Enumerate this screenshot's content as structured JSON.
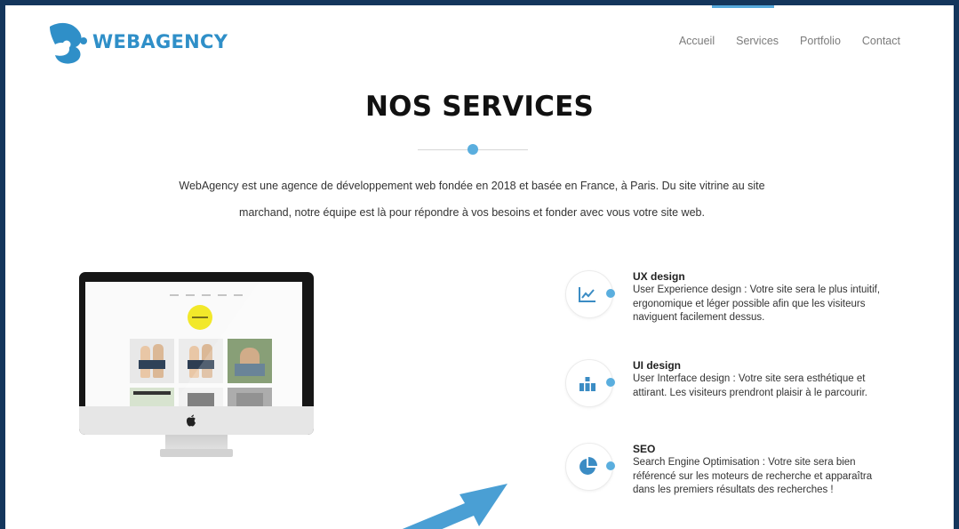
{
  "brand": {
    "name": "WEBAGENCY",
    "color": "#2f8fc8"
  },
  "nav": {
    "items": [
      "Accueil",
      "Services",
      "Portfolio",
      "Contact"
    ],
    "active": "Services"
  },
  "section": {
    "title": "NOS SERVICES",
    "intro": [
      "WebAgency est une agence de développement web fondée en 2018 et basée en France, à Paris. Du site vitrine au site",
      "marchand, notre équipe est là pour répondre à vos besoins et fonder avec vous votre site web."
    ]
  },
  "services": [
    {
      "icon": "chart-line-icon",
      "title": "UX design",
      "desc": [
        "User Experience design : Votre site sera le plus intuitif,",
        "ergonomique et léger possible afin que les visiteurs",
        "naviguent facilement dessus."
      ]
    },
    {
      "icon": "blocks-icon",
      "title": "UI design",
      "desc": [
        "User Interface design : Votre site sera esthétique et",
        "attirant. Les visiteurs prendront plaisir à le parcourir."
      ]
    },
    {
      "icon": "pie-chart-icon",
      "title": "SEO",
      "desc": [
        "Search Engine Optimisation : Votre site sera bien",
        "référencé sur les moteurs de recherche et apparaîtra",
        "dans les premiers résultats des recherches !"
      ]
    }
  ],
  "colors": {
    "accent": "#5aaede",
    "frame": "#14365c",
    "title": "#111111",
    "nav": "#7b7b7b"
  }
}
